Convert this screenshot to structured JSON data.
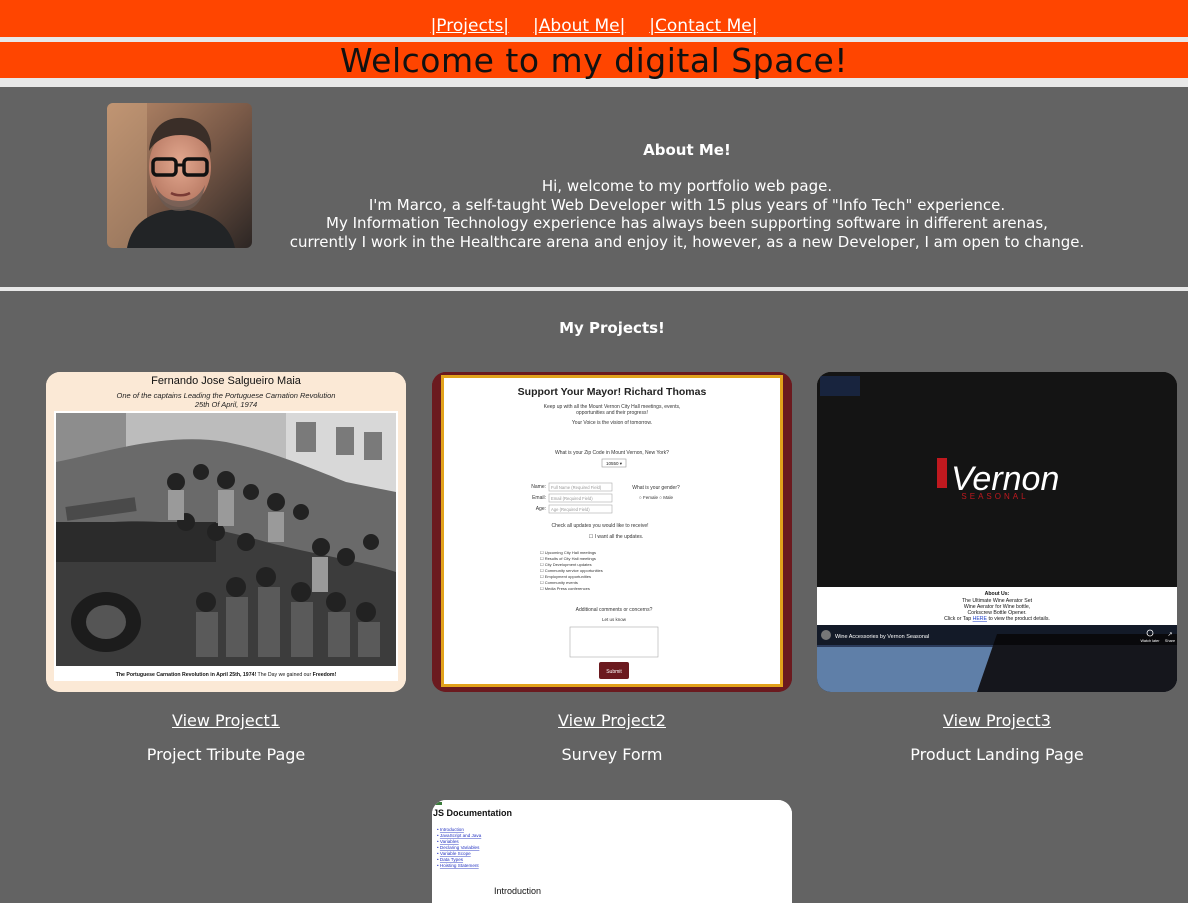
{
  "nav": {
    "items": [
      {
        "label": "|Projects|"
      },
      {
        "label": "|About Me|"
      },
      {
        "label": "|Contact Me|"
      }
    ]
  },
  "banner": {
    "title": "Welcome to my digital Space!"
  },
  "about": {
    "heading": "About Me!",
    "lines": [
      "Hi, welcome to my portfolio web page.",
      "I'm Marco, a self-taught Web Developer with 15 plus years of \"Info Tech\" experience.",
      "My Information Technology experience has always been supporting software in different arenas,",
      "currently I work in the Healthcare arena and enjoy it, however, as a new Developer, I am open to change."
    ]
  },
  "projects": {
    "heading": "My Projects!",
    "items": [
      {
        "link": "View Project1",
        "desc": "Project Tribute Page",
        "thumb": {
          "title": "Fernando Jose Salgueiro Maia",
          "subtitle": "One of the captains Leading the Portuguese Carnation Revolution",
          "date": "25th Of April, 1974",
          "caption_bold": "The Portuguese Carnation Revolution in April 25th, 1974!",
          "caption_rest": " The Day we gained our ",
          "caption_end": "Freedom!"
        }
      },
      {
        "link": "View Project2",
        "desc": "Survey Form",
        "thumb": {
          "title": "Support Your Mayor! Richard Thomas",
          "intro1": "Keep up with all the Mount Vernon City Hall meetings, events,",
          "intro2": "opportunities and their progress!",
          "tagline": "Your Voice is the vision of tomorrow.",
          "zip_q": "What is your Zip Code in Mount Vernon, New York?",
          "zip_value": "10550 ▾",
          "name_label": "Name:",
          "name_ph": "Full Name (Required Field)",
          "email_label": "Email:",
          "email_ph": "Email (Required Field)",
          "age_label": "Age:",
          "age_ph": "Age (Required Field)",
          "gender_q": "What is your gender?",
          "gender_opts": "○ Female ○ Male",
          "updates_q": "Check all updates you would like to receive!",
          "all_updates": "☐ I want all the updates.",
          "check_items": [
            "☐ Upcoming City Hall meetings",
            "☐ Results of City Hall meetings",
            "☐ City Development updates",
            "☐ Community service opportunities",
            "☐ Employment opportunities",
            "☐ Community events",
            "☐ Media Press conferences"
          ],
          "comments_q": "Additional comments or concerns?",
          "comments_ph": "Let us know",
          "submit": "Submit"
        }
      },
      {
        "link": "View Project3",
        "desc": "Product Landing Page",
        "thumb": {
          "brand": "Vernon",
          "brand_sub": "SEASONAL",
          "about_title": "About Us:",
          "about1": "The Ultimate Wine Aerator Set",
          "about2": "Wine Aerator for Wine bottle,",
          "about3": "Corkscrew Bottle Opener.",
          "about4a": "Click or Tap ",
          "about4link": "HERE",
          "about4b": " to view the product details.",
          "video_title": "Wine Accessories by Vernon Seasonal",
          "watch_later": "Watch later",
          "share": "Share"
        }
      },
      {
        "thumb": {
          "title": "JS Documentation",
          "links": [
            "Introduction",
            "JavaScript and Java",
            "Variables",
            "Declaring Variables",
            "Variable Scope",
            "Data Types",
            "Hoisting Statement"
          ],
          "section": "Introduction"
        }
      }
    ]
  },
  "colors": {
    "accent": "#ff4500",
    "panel": "#636363",
    "divider": "#e8e8e8"
  }
}
